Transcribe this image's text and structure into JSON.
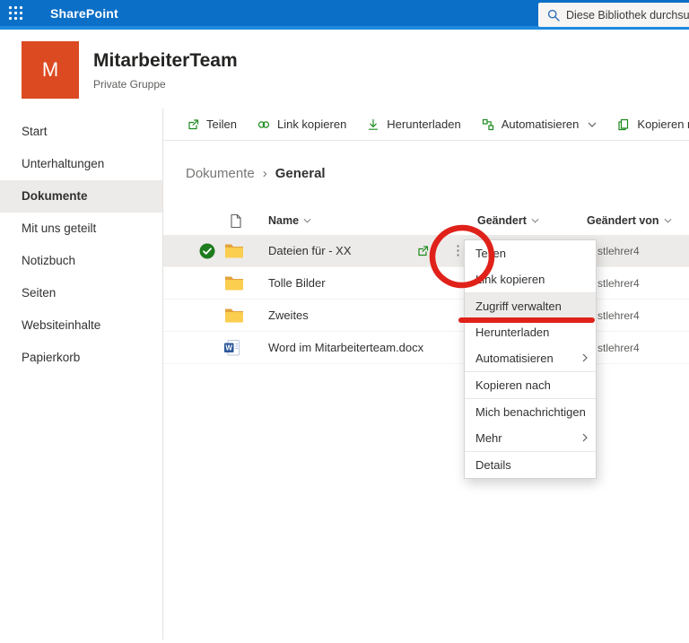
{
  "topbar": {
    "app_name": "SharePoint",
    "search_placeholder": "Diese Bibliothek durchsuchen"
  },
  "site": {
    "initial": "M",
    "title": "MitarbeiterTeam",
    "subtitle": "Private Gruppe",
    "avatar_color": "#dc4a21"
  },
  "sidebar": {
    "items": [
      {
        "label": "Start",
        "selected": false
      },
      {
        "label": "Unterhaltungen",
        "selected": false
      },
      {
        "label": "Dokumente",
        "selected": true
      },
      {
        "label": "Mit uns geteilt",
        "selected": false
      },
      {
        "label": "Notizbuch",
        "selected": false
      },
      {
        "label": "Seiten",
        "selected": false
      },
      {
        "label": "Websiteinhalte",
        "selected": false
      },
      {
        "label": "Papierkorb",
        "selected": false
      }
    ]
  },
  "toolbar": {
    "icon_color": "#1e8a1e",
    "items": [
      {
        "label": "Teilen",
        "icon": "share-icon"
      },
      {
        "label": "Link kopieren",
        "icon": "link-icon"
      },
      {
        "label": "Herunterladen",
        "icon": "download-icon"
      },
      {
        "label": "Automatisieren",
        "icon": "automate-icon",
        "has_dropdown": true
      },
      {
        "label": "Kopieren nach",
        "icon": "copy-icon"
      }
    ],
    "more_glyph": "···"
  },
  "breadcrumb": {
    "parent": "Dokumente",
    "separator": "›",
    "current": "General"
  },
  "table": {
    "columns": [
      "Name",
      "Geändert",
      "Geändert von"
    ],
    "rows": [
      {
        "name": "Dateien für - XX",
        "type": "folder",
        "modified_by": "stlehrer4",
        "selected": true
      },
      {
        "name": "Tolle Bilder",
        "type": "folder",
        "modified_by": "stlehrer4",
        "selected": false
      },
      {
        "name": "Zweites",
        "type": "folder",
        "modified_by": "stlehrer4",
        "selected": false
      },
      {
        "name": "Word im Mitarbeiterteam.docx",
        "type": "word",
        "modified_by": "stlehrer4",
        "selected": false
      }
    ]
  },
  "row_actions": {
    "dots_glyph": "⋮"
  },
  "context_menu": {
    "items": [
      {
        "label": "Teilen",
        "highlighted": false
      },
      {
        "label": "Link kopieren",
        "highlighted": false
      },
      {
        "label": "Zugriff verwalten",
        "highlighted": true
      },
      {
        "label": "Herunterladen",
        "highlighted": false
      },
      {
        "label": "Automatisieren",
        "has_submenu": true,
        "highlighted": false
      },
      {
        "label": "Kopieren nach",
        "highlighted": false
      },
      {
        "label": "Mich benachrichtigen",
        "highlighted": false
      },
      {
        "label": "Mehr",
        "has_submenu": true,
        "highlighted": false
      },
      {
        "label": "Details",
        "highlighted": false
      }
    ]
  },
  "annotations": {
    "color": "#e0211a"
  }
}
